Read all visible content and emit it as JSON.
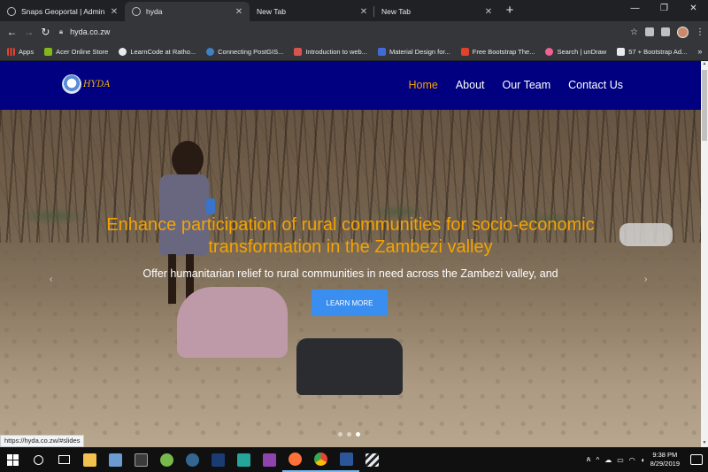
{
  "browser": {
    "tabs": [
      {
        "title": "Snaps Geoportal | Admin",
        "active": false,
        "icon": "globe-icon"
      },
      {
        "title": "hyda",
        "active": true,
        "icon": "globe-icon"
      },
      {
        "title": "New Tab",
        "active": false,
        "icon": "none"
      },
      {
        "title": "New Tab",
        "active": false,
        "icon": "none"
      }
    ],
    "new_tab_label": "+",
    "url": "hyda.co.zw",
    "bookmarks": [
      {
        "label": "Apps",
        "color": "#e94235"
      },
      {
        "label": "Acer Online Store",
        "color": "#83b81a"
      },
      {
        "label": "LearnCode at Ratho...",
        "color": "#e8eaed"
      },
      {
        "label": "Connecting PostGIS...",
        "color": "#3e82c4"
      },
      {
        "label": "Introduction to web...",
        "color": "#d9534f"
      },
      {
        "label": "Material Design for...",
        "color": "#3f6ad8"
      },
      {
        "label": "Free Bootstrap The...",
        "color": "#e2412c"
      },
      {
        "label": "Search | unDraw",
        "color": "#f06292"
      },
      {
        "label": "57 + Bootstrap Ad...",
        "color": "#202124"
      }
    ],
    "bookmarks_more": "»",
    "status_url": "https://hyda.co.zw/#slides"
  },
  "site": {
    "logo_text": "HYDA",
    "nav": [
      {
        "label": "Home",
        "active": true
      },
      {
        "label": "About",
        "active": false
      },
      {
        "label": "Our Team",
        "active": false
      },
      {
        "label": "Contact Us",
        "active": false
      }
    ],
    "hero": {
      "title": "Enhance participation of rural communities for socio-economic transformation in the Zambezi valley",
      "subtitle": "Offer humanitarian relief to rural communities in need across the Zambezi valley, and",
      "cta_label": "LEARN MORE",
      "active_slide": 3,
      "slide_count": 3
    },
    "colors": {
      "nav_bg": "#000080",
      "accent": "#f5a300",
      "cta": "#3a8ef0"
    }
  },
  "taskbar": {
    "time": "9:38 PM",
    "date": "8/29/2019",
    "apps": [
      {
        "name": "file-explorer-icon",
        "color": "#f2c14e"
      },
      {
        "name": "notepad-icon",
        "color": "#6c9bd2"
      },
      {
        "name": "terminal-icon",
        "color": "#3b3b3b"
      },
      {
        "name": "qgis-icon",
        "color": "#79b84a"
      },
      {
        "name": "pgadmin-icon",
        "color": "#336791"
      },
      {
        "name": "photoshop-icon",
        "color": "#1b3b73"
      },
      {
        "name": "datagrip-icon",
        "color": "#26a69a"
      },
      {
        "name": "phpstorm-icon",
        "color": "#8e44ad"
      },
      {
        "name": "firefox-icon",
        "color": "#ff7139"
      },
      {
        "name": "chrome-icon",
        "color": "#4caf50"
      },
      {
        "name": "word-icon",
        "color": "#2b579a"
      },
      {
        "name": "video-editor-icon",
        "color": "#e8eaed"
      }
    ]
  }
}
